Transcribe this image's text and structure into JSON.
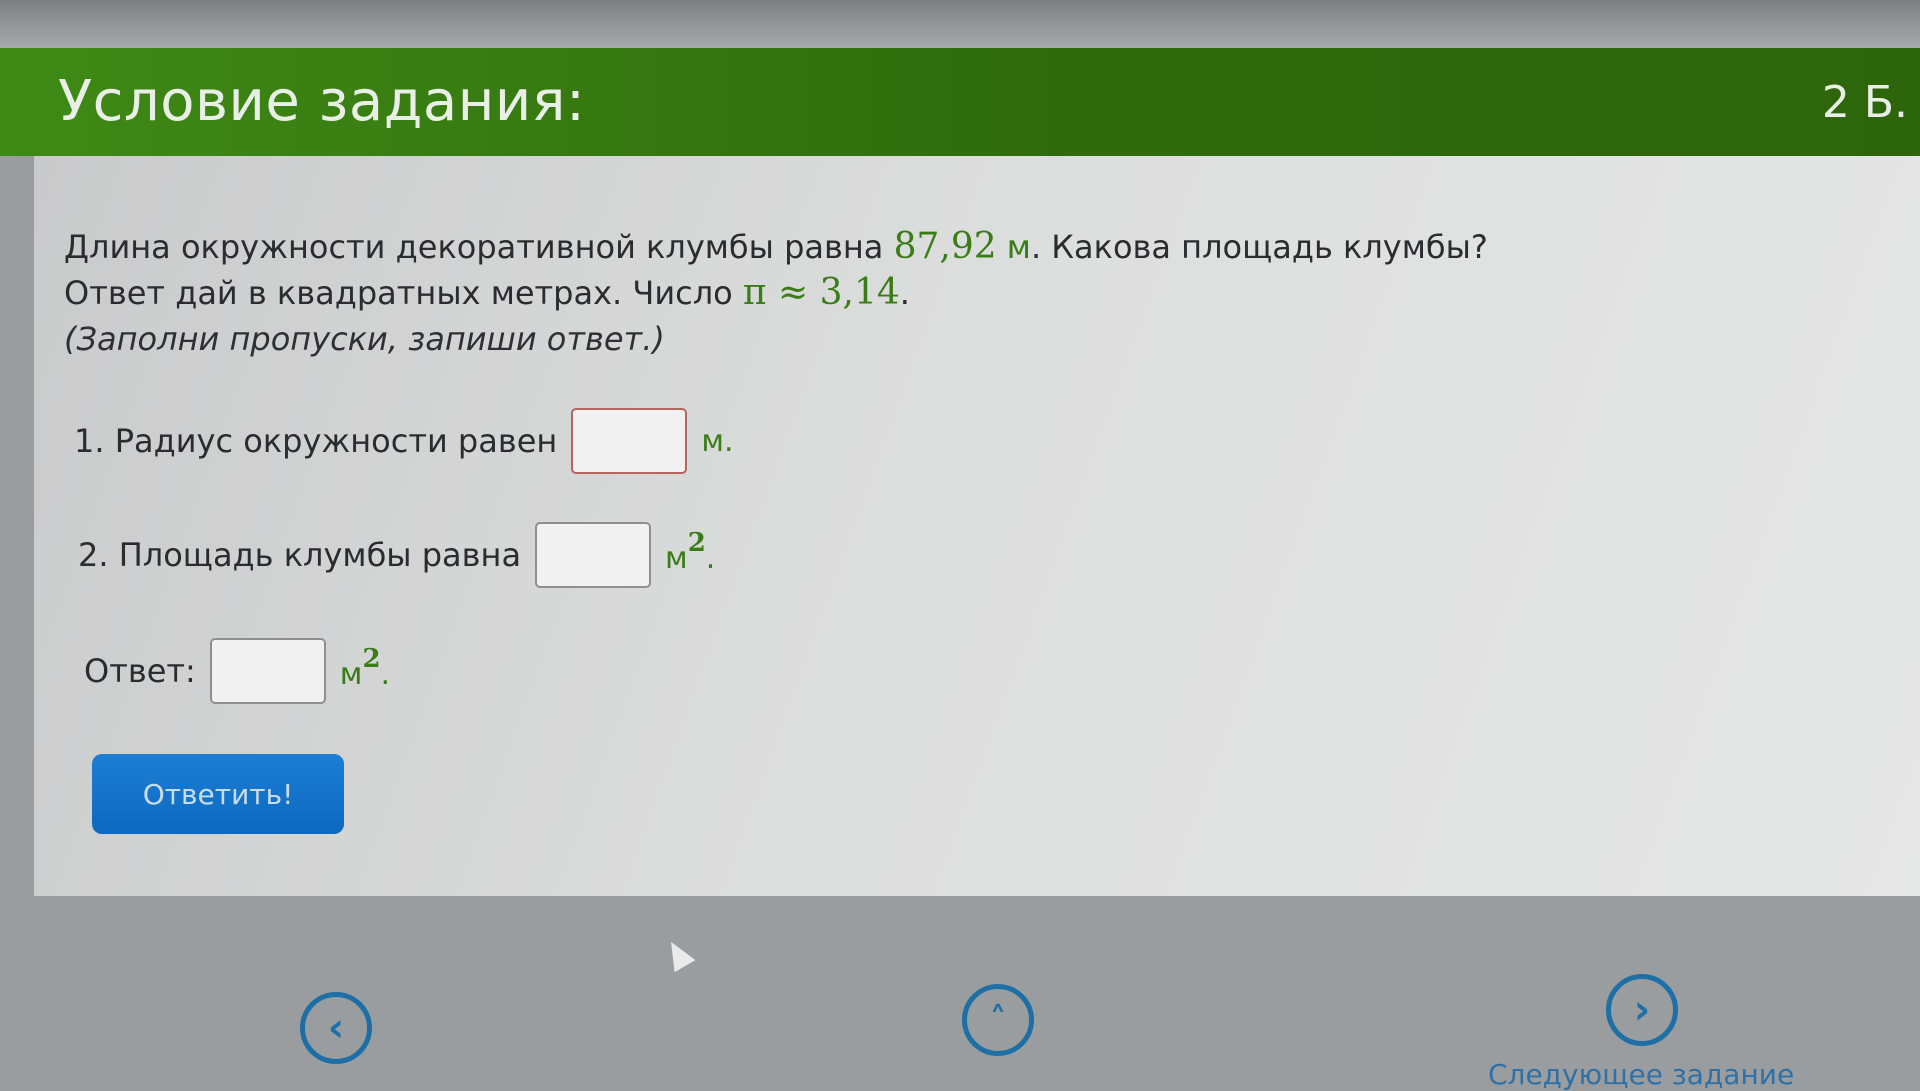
{
  "header": {
    "title": "Условие задания:",
    "points": "2 Б."
  },
  "problem": {
    "line1_pre": "Длина окружности декоративной клумбы равна",
    "length_value": "87,92",
    "length_unit": "м",
    "line1_post": ". Какова площадь клумбы?",
    "line2_pre": "Ответ дай в квадратных метрах. Число",
    "pi_expr": "π ≈ 3,14",
    "line2_post": ".",
    "hint": "(Заполни пропуски, запиши ответ.)"
  },
  "steps": [
    {
      "label": "1. Радиус окружности равен",
      "value": "",
      "unit": "м",
      "unit_sup": "",
      "unit_end": "."
    },
    {
      "label": "2. Площадь клумбы равна",
      "value": "",
      "unit": "м",
      "unit_sup": "2",
      "unit_end": "."
    }
  ],
  "answer": {
    "label": "Ответ:",
    "value": "",
    "unit": "м",
    "unit_sup": "2",
    "unit_end": "."
  },
  "submit": {
    "label": "Ответить!"
  },
  "nav": {
    "prev_icon": "chevron-left-icon",
    "up_icon": "chevron-up-icon",
    "next_icon": "chevron-right-icon",
    "next_label": "Следующее задание"
  },
  "colors": {
    "header": "#2f6b0c",
    "accent_green": "#3a7d17",
    "button": "#0d69c0",
    "nav": "#1d6fa6"
  }
}
